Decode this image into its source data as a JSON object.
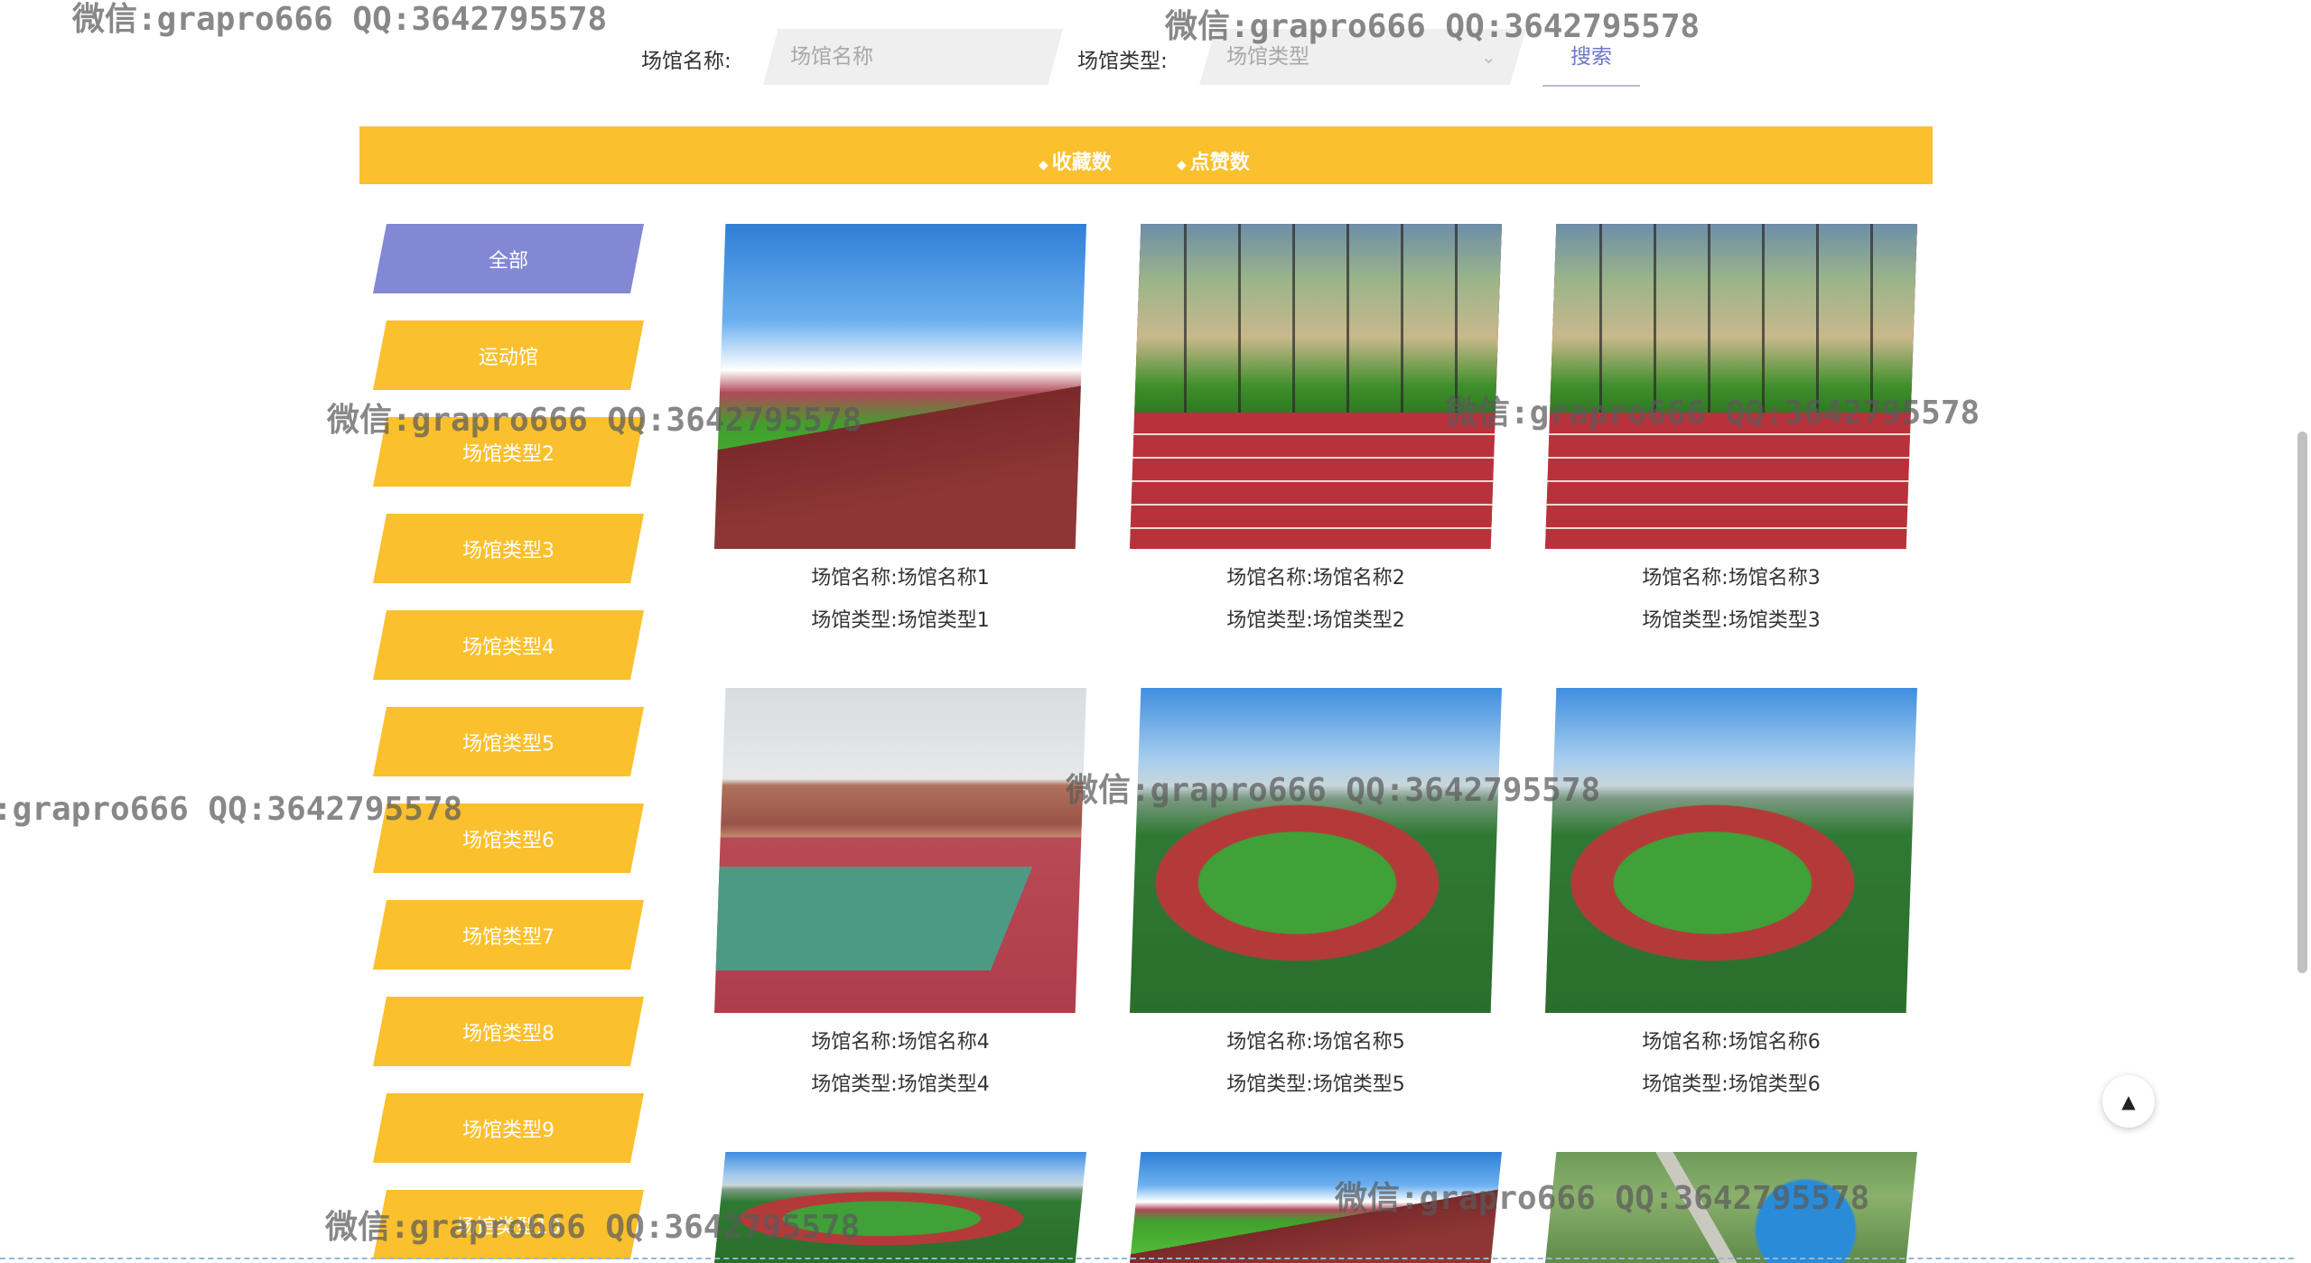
{
  "search": {
    "name_label": "场馆名称:",
    "name_placeholder": "场馆名称",
    "type_label": "场馆类型:",
    "type_placeholder": "场馆类型",
    "search_button": "搜索"
  },
  "sort": {
    "favorites": "收藏数",
    "likes": "点赞数"
  },
  "categories": [
    "全部",
    "运动馆",
    "场馆类型2",
    "场馆类型3",
    "场馆类型4",
    "场馆类型5",
    "场馆类型6",
    "场馆类型7",
    "场馆类型8",
    "场馆类型9",
    "场馆类型10"
  ],
  "venues": [
    {
      "name_line": "场馆名称:场馆名称1",
      "type_line": "场馆类型:场馆类型1"
    },
    {
      "name_line": "场馆名称:场馆名称2",
      "type_line": "场馆类型:场馆类型2"
    },
    {
      "name_line": "场馆名称:场馆名称3",
      "type_line": "场馆类型:场馆类型3"
    },
    {
      "name_line": "场馆名称:场馆名称4",
      "type_line": "场馆类型:场馆类型4"
    },
    {
      "name_line": "场馆名称:场馆名称5",
      "type_line": "场馆类型:场馆类型5"
    },
    {
      "name_line": "场馆名称:场馆名称6",
      "type_line": "场馆类型:场馆类型6"
    }
  ],
  "watermark": "微信:grapro666 QQ:3642795578",
  "watermark_cut": ":grapro666 QQ:3642795578",
  "colors": {
    "accent_yellow": "#fbc02d",
    "active_purple": "#8288d4",
    "search_link": "#6e78c8"
  }
}
